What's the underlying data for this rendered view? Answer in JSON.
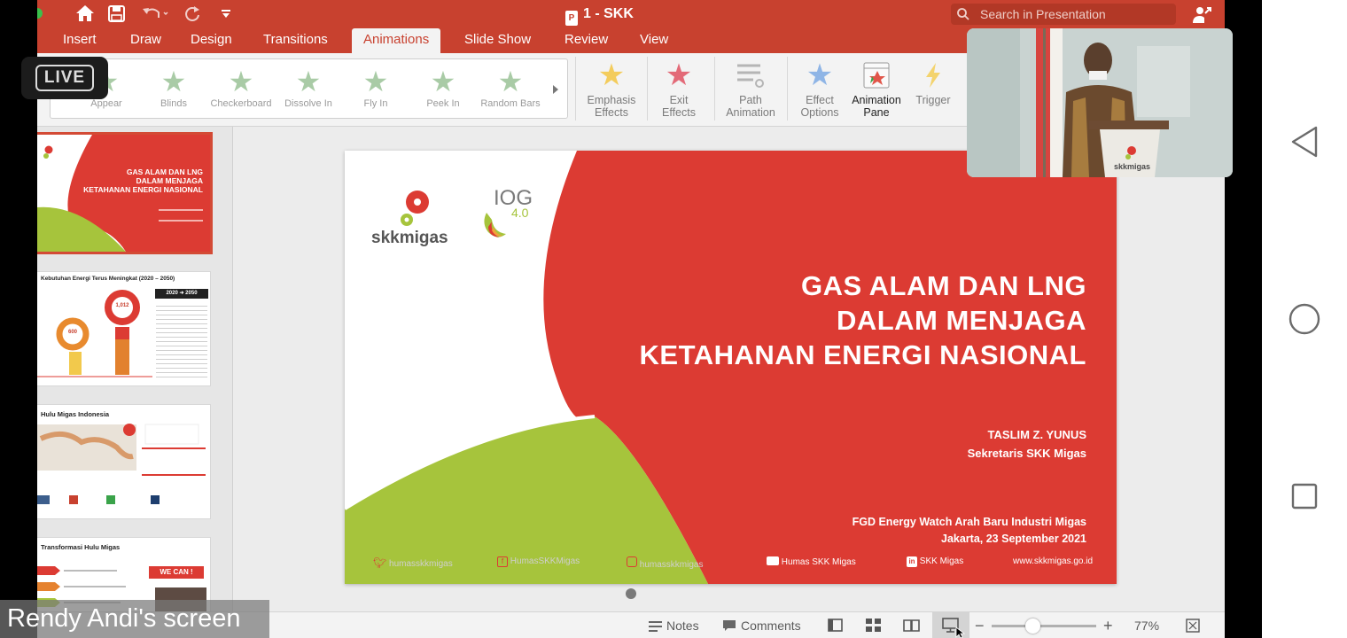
{
  "window": {
    "title": "1 - SKK",
    "search_placeholder": "Search in Presentation"
  },
  "tabs": [
    "Insert",
    "Draw",
    "Design",
    "Transitions",
    "Animations",
    "Slide Show",
    "Review",
    "View"
  ],
  "active_tab": "Animations",
  "gallery_items": [
    "Appear",
    "Blinds",
    "Checkerboard",
    "Dissolve In",
    "Fly In",
    "Peek In",
    "Random Bars"
  ],
  "ribbon": {
    "emphasis": [
      "Emphasis",
      "Effects"
    ],
    "exit": [
      "Exit",
      "Effects"
    ],
    "path": [
      "Path",
      "Animation"
    ],
    "effect_options": [
      "Effect",
      "Options"
    ],
    "animation_pane": [
      "Animation",
      "Pane"
    ],
    "trigger": "Trigger"
  },
  "overlay": {
    "live_label": "LIVE",
    "screen_label": "Rendy Andi's screen"
  },
  "thumbnails": {
    "t1": {
      "title": [
        "GAS ALAM DAN LNG",
        "DALAM MENJAGA",
        "KETAHANAN ENERGI NASIONAL"
      ]
    },
    "t2": {
      "title": "Kebutuhan Energi Terus Meningkat (2020 – 2050)",
      "badge": "2020 ➜ 2050",
      "donut1": "600",
      "donut2": "1,012"
    },
    "t3": {
      "title": "Hulu Migas Indonesia"
    },
    "t4": {
      "title": "Transformasi Hulu Migas",
      "banner": "WE CAN !"
    }
  },
  "slide": {
    "logo_text": "skkmigas",
    "iog_text": "IOG",
    "iog_version": "4.0",
    "title_lines": [
      "GAS ALAM DAN LNG",
      "DALAM MENJAGA",
      "KETAHANAN ENERGI NASIONAL"
    ],
    "author": "TASLIM Z. YUNUS",
    "author_role": "Sekretaris SKK Migas",
    "event": "FGD Energy Watch Arah Baru Industri Migas",
    "event_date": "Jakarta, 23 September 2021",
    "footer": [
      "humasskkmigas",
      "HumasSKKMigas",
      "humasskkmigas",
      "Humas SKK Migas",
      "SKK Migas",
      "www.skkmigas.go.id"
    ]
  },
  "statusbar": {
    "notes": "Notes",
    "comments": "Comments",
    "zoom": "77%"
  },
  "video": {
    "podium_label": "skkmigas"
  },
  "colors": {
    "brand_red": "#c8412f",
    "slide_red": "#dc3b33",
    "slide_green": "#a6c43c"
  }
}
